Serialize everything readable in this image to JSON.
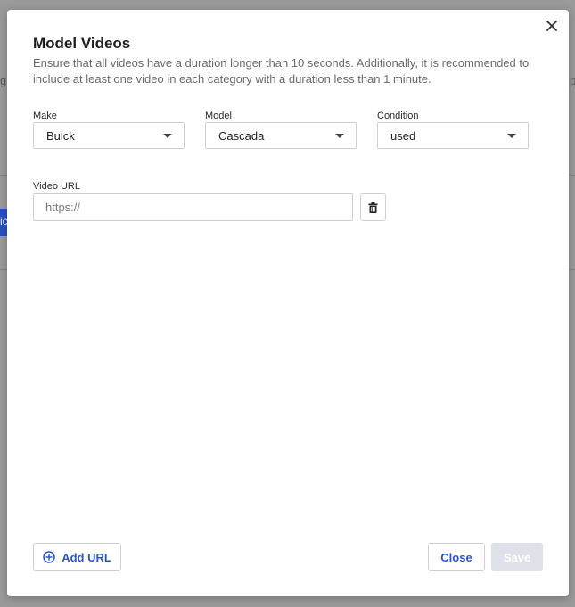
{
  "background": {
    "fragment_left_1": "g",
    "fragment_left_2": "ic",
    "fragment_right": "p"
  },
  "modal": {
    "title": "Model Videos",
    "subtitle": "Ensure that all videos have a duration longer than 10 seconds. Additionally, it is recommended to include at least one video in each category with a duration less than 1 minute.",
    "close_icon": "close-icon"
  },
  "filters": {
    "make": {
      "label": "Make",
      "value": "Buick"
    },
    "model": {
      "label": "Model",
      "value": "Cascada"
    },
    "condition": {
      "label": "Condition",
      "value": "used"
    }
  },
  "video": {
    "label": "Video URL",
    "placeholder": "https://",
    "value": "",
    "delete_icon": "trash-icon"
  },
  "footer": {
    "add_url_label": "Add URL",
    "add_icon": "plus-circle-icon",
    "close_label": "Close",
    "save_label": "Save"
  },
  "colors": {
    "accent": "#2d55c8",
    "disabled": "#dfe1e8",
    "overlay": "#9a9a9a"
  }
}
